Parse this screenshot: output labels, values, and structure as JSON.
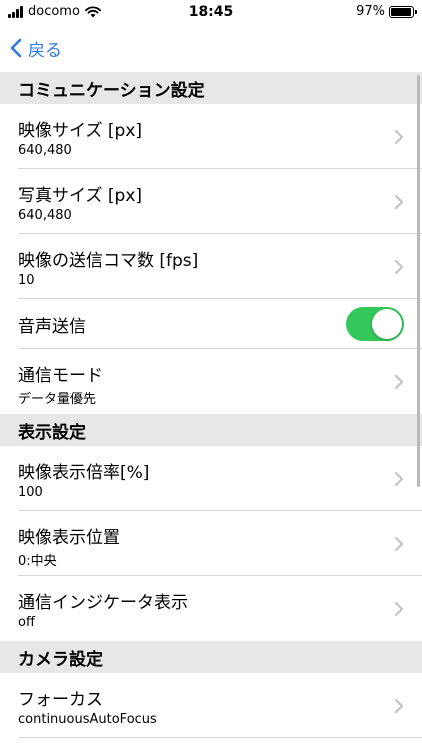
{
  "status_bar": {
    "carrier": "docomo",
    "time": "18:45",
    "battery": "97%",
    "battery_level": 0.97,
    "signal_icon": "signal-bars-icon",
    "wifi_icon": "wifi-icon",
    "battery_icon": "battery-icon"
  },
  "nav": {
    "back_label": "戻る",
    "back_icon": "chevron-left-icon"
  },
  "sections": {
    "communication": {
      "header": "コミュニケーション設定",
      "video_size": {
        "title": "映像サイズ [px]",
        "value": "640,480"
      },
      "photo_size": {
        "title": "写真サイズ [px]",
        "value": "640,480"
      },
      "video_fps": {
        "title": "映像の送信コマ数 [fps]",
        "value": "10"
      },
      "audio_send": {
        "title": "音声送信",
        "enabled": true
      },
      "comm_mode": {
        "title": "通信モード",
        "value": "データ量優先"
      }
    },
    "display": {
      "header": "表示設定",
      "zoom": {
        "title": "映像表示倍率[%]",
        "value": "100"
      },
      "position": {
        "title": "映像表示位置",
        "value": "0:中央"
      },
      "indicator": {
        "title": "通信インジケータ表示",
        "value": "off"
      }
    },
    "camera": {
      "header": "カメラ設定",
      "focus": {
        "title": "フォーカス",
        "value": "continuousAutoFocus"
      }
    }
  },
  "colors": {
    "accent": "#2f7ae5",
    "toggle_on": "#34c759",
    "section_bg": "#e7e7ea",
    "chevron": "#c4c4c7"
  }
}
